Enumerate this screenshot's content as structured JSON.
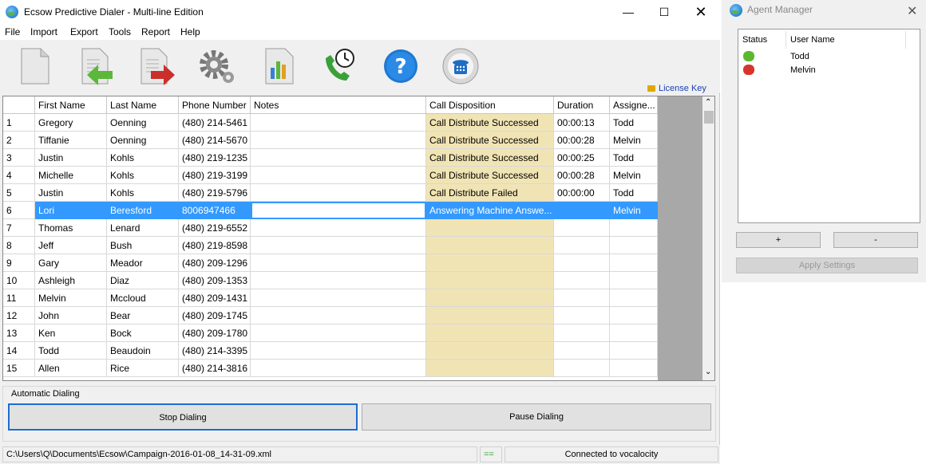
{
  "window": {
    "title": "Ecsow Predictive Dialer - Multi-line Edition"
  },
  "menu": [
    "File",
    "Import",
    "Export",
    "Tools",
    "Report",
    "Help"
  ],
  "toolbar": {
    "icons": [
      "new-document-icon",
      "import-icon",
      "export-icon",
      "settings-icon",
      "report-icon",
      "phone-schedule-icon",
      "help-icon",
      "dialer-icon"
    ],
    "license_label": "License Key"
  },
  "grid": {
    "columns": [
      "",
      "First Name",
      "Last Name",
      "Phone Number",
      "Notes",
      "Call Disposition",
      "Duration",
      "Assigne..."
    ],
    "rows": [
      [
        "1",
        "Gregory",
        "Oenning",
        "(480) 214-5461",
        "",
        "Call Distribute Successed",
        "00:00:13",
        "Todd"
      ],
      [
        "2",
        "Tiffanie",
        "Oenning",
        "(480) 214-5670",
        "",
        "Call Distribute Successed",
        "00:00:28",
        "Melvin"
      ],
      [
        "3",
        "Justin",
        "Kohls",
        "(480) 219-1235",
        "",
        "Call Distribute Successed",
        "00:00:25",
        "Todd"
      ],
      [
        "4",
        "Michelle",
        "Kohls",
        "(480) 219-3199",
        "",
        "Call Distribute Successed",
        "00:00:28",
        "Melvin"
      ],
      [
        "5",
        "Justin",
        "Kohls",
        "(480) 219-5796",
        "",
        "Call Distribute Failed",
        "00:00:00",
        "Todd"
      ],
      [
        "6",
        "Lori",
        "Beresford",
        "8006947466",
        "",
        "Answering Machine Answe...",
        "",
        "Melvin"
      ],
      [
        "7",
        "Thomas",
        "Lenard",
        "(480) 219-6552",
        "",
        "",
        "",
        ""
      ],
      [
        "8",
        "Jeff",
        "Bush",
        "(480) 219-8598",
        "",
        "",
        "",
        ""
      ],
      [
        "9",
        "Gary",
        "Meador",
        "(480) 209-1296",
        "",
        "",
        "",
        ""
      ],
      [
        "10",
        "Ashleigh",
        "Diaz",
        "(480) 209-1353",
        "",
        "",
        "",
        ""
      ],
      [
        "11",
        "Melvin",
        "Mccloud",
        "(480) 209-1431",
        "",
        "",
        "",
        ""
      ],
      [
        "12",
        "John",
        "Bear",
        "(480) 209-1745",
        "",
        "",
        "",
        ""
      ],
      [
        "13",
        "Ken",
        "Bock",
        "(480) 209-1780",
        "",
        "",
        "",
        ""
      ],
      [
        "14",
        "Todd",
        "Beaudoin",
        "(480) 214-3395",
        "",
        "",
        "",
        ""
      ],
      [
        "15",
        "Allen",
        "Rice",
        "(480) 214-3816",
        "",
        "",
        "",
        ""
      ]
    ],
    "selected_row": 6
  },
  "dialing": {
    "group_label": "Automatic Dialing",
    "stop_label": "Stop Dialing",
    "pause_label": "Pause Dialing"
  },
  "statusbar": {
    "path": "C:\\Users\\Q\\Documents\\Ecsow\\Campaign-2016-01-08_14-31-09.xml",
    "indicator": "==",
    "connection": "Connected to vocalocity"
  },
  "agent_manager": {
    "title": "Agent Manager",
    "columns": [
      "Status",
      "User Name"
    ],
    "agents": [
      {
        "status": "online",
        "name": "Todd"
      },
      {
        "status": "offline",
        "name": "Melvin"
      }
    ],
    "add_label": "+",
    "remove_label": "-",
    "apply_label": "Apply Settings"
  },
  "colors": {
    "accent": "#3399ff",
    "disposition_bg": "#f1e4b4",
    "online": "#5cb82e",
    "offline": "#d9342b"
  }
}
